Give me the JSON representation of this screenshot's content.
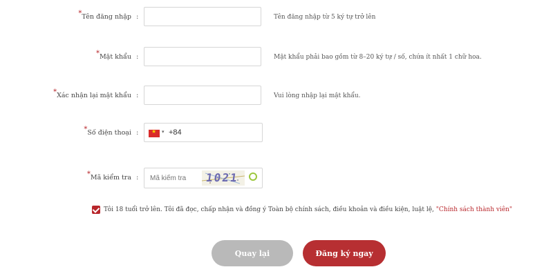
{
  "form": {
    "username": {
      "label": "Tên đăng nhập",
      "required_mark": "*",
      "colon": ":",
      "value": "",
      "hint": "Tên đăng nhập từ 5 ký tự trở lên"
    },
    "password": {
      "label": "Mật khẩu",
      "required_mark": "*",
      "colon": ":",
      "value": "",
      "hint": "Mật khẩu phải bao gồm từ 8–20 ký tự / số, chứa ít nhất 1 chữ hoa."
    },
    "confirm_password": {
      "label": "Xác nhận lại mật khẩu",
      "required_mark": "*",
      "colon": ":",
      "value": "",
      "hint": "Vui lòng nhập lại mật khẩu."
    },
    "phone": {
      "label": "Số điện thoại",
      "required_mark": "*",
      "colon": ":",
      "country_code": "+84",
      "flag_icon": "vietnam-flag-icon",
      "caret": "▾"
    },
    "captcha": {
      "label": "Mã kiểm tra",
      "required_mark": "*",
      "colon": ":",
      "placeholder": "Mã kiểm tra",
      "code": "1021",
      "refresh_icon": "refresh-icon"
    }
  },
  "agreement": {
    "checked": true,
    "text": "Tôi 18 tuổi trở lên. Tôi đã đọc, chấp nhận và đồng ý Toàn bộ chính sách, điều khoản và điều kiện, luật lệ, ",
    "link_text": "\"Chính sách thành viên\""
  },
  "buttons": {
    "back": "Quay lại",
    "register": "Đăng ký ngay"
  },
  "colors": {
    "accent": "#b8262b",
    "button_gray": "#b9b9b9",
    "captcha_text": "#6c6ab0",
    "refresh": "#9cc73d"
  }
}
